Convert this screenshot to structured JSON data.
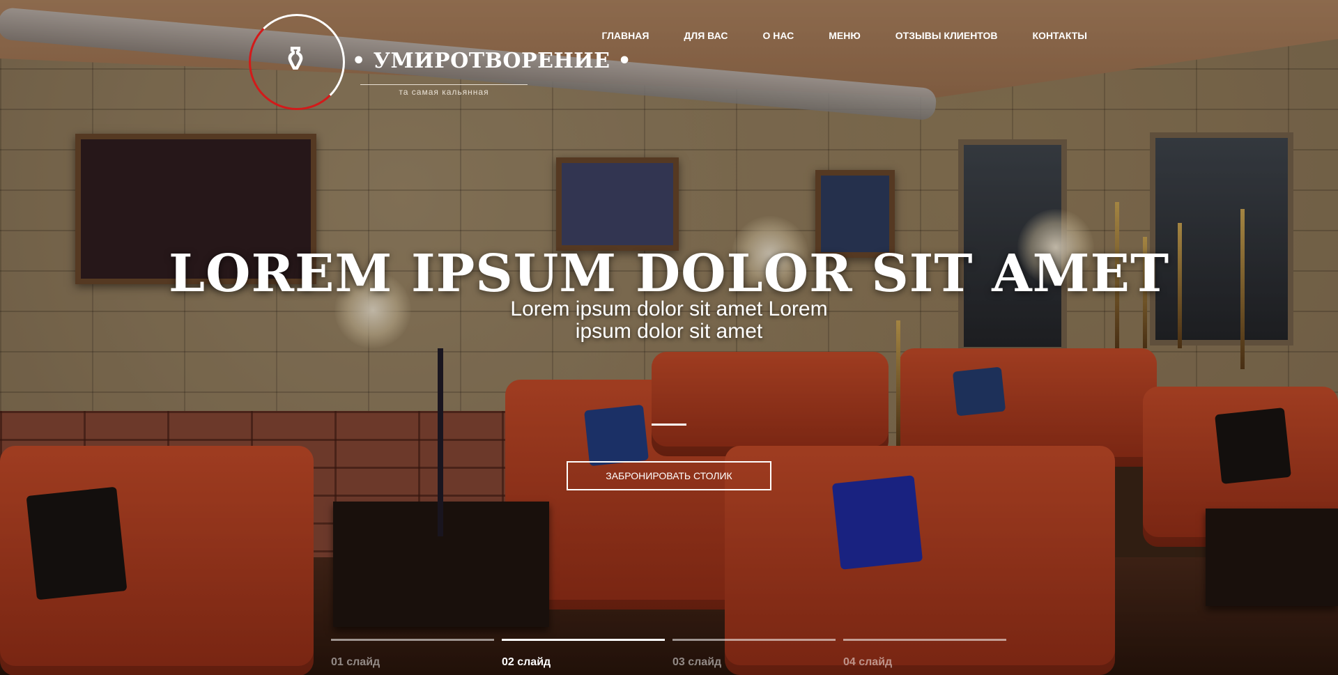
{
  "brand": {
    "name": "• УМИРОТВОРЕНИЕ •",
    "tagline": "та самая кальянная"
  },
  "nav": [
    {
      "label": "ГЛАВНАЯ"
    },
    {
      "label": "ДЛЯ ВАС"
    },
    {
      "label": "О НАС"
    },
    {
      "label": "МЕНЮ"
    },
    {
      "label": "ОТЗЫВЫ КЛИЕНТОВ"
    },
    {
      "label": "КОНТАКТЫ"
    }
  ],
  "hero": {
    "title": "LOREM IPSUM DOLOR SIT AMET",
    "subtitle": "Lorem ipsum dolor sit amet Lorem ipsum dolor sit amet",
    "cta_label": "ЗАБРОНИРОВАТЬ СТОЛИК"
  },
  "slides": [
    {
      "label": "01 слайд",
      "active": false
    },
    {
      "label": "02 слайд",
      "active": true
    },
    {
      "label": "03 слайд",
      "active": false
    },
    {
      "label": "04 слайд",
      "active": false
    }
  ],
  "colors": {
    "accent_red": "#d31a1a",
    "text": "#ffffff"
  },
  "icons": {
    "logo": "hookah-logo-icon"
  }
}
